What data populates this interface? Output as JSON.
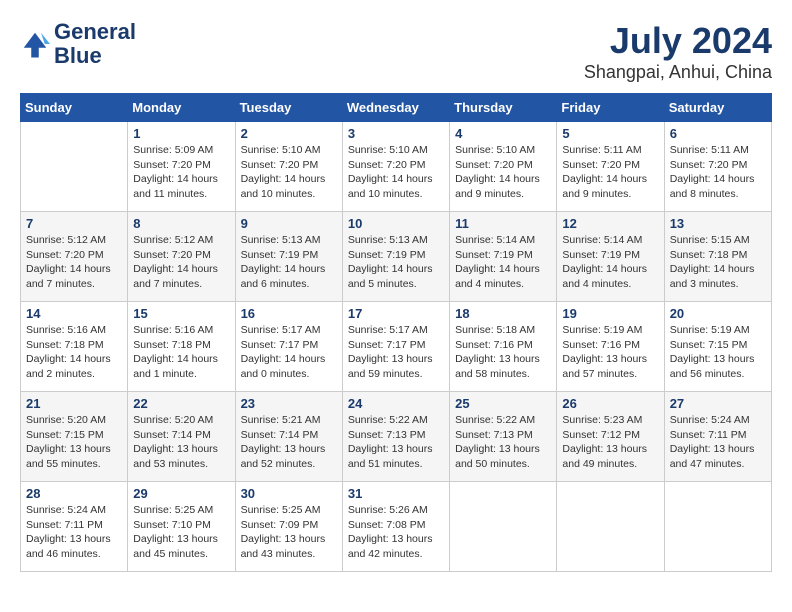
{
  "header": {
    "logo_line1": "General",
    "logo_line2": "Blue",
    "main_title": "July 2024",
    "subtitle": "Shangpai, Anhui, China"
  },
  "calendar": {
    "days_of_week": [
      "Sunday",
      "Monday",
      "Tuesday",
      "Wednesday",
      "Thursday",
      "Friday",
      "Saturday"
    ],
    "weeks": [
      [
        {
          "day": "",
          "info": ""
        },
        {
          "day": "1",
          "info": "Sunrise: 5:09 AM\nSunset: 7:20 PM\nDaylight: 14 hours\nand 11 minutes."
        },
        {
          "day": "2",
          "info": "Sunrise: 5:10 AM\nSunset: 7:20 PM\nDaylight: 14 hours\nand 10 minutes."
        },
        {
          "day": "3",
          "info": "Sunrise: 5:10 AM\nSunset: 7:20 PM\nDaylight: 14 hours\nand 10 minutes."
        },
        {
          "day": "4",
          "info": "Sunrise: 5:10 AM\nSunset: 7:20 PM\nDaylight: 14 hours\nand 9 minutes."
        },
        {
          "day": "5",
          "info": "Sunrise: 5:11 AM\nSunset: 7:20 PM\nDaylight: 14 hours\nand 9 minutes."
        },
        {
          "day": "6",
          "info": "Sunrise: 5:11 AM\nSunset: 7:20 PM\nDaylight: 14 hours\nand 8 minutes."
        }
      ],
      [
        {
          "day": "7",
          "info": "Sunrise: 5:12 AM\nSunset: 7:20 PM\nDaylight: 14 hours\nand 7 minutes."
        },
        {
          "day": "8",
          "info": "Sunrise: 5:12 AM\nSunset: 7:20 PM\nDaylight: 14 hours\nand 7 minutes."
        },
        {
          "day": "9",
          "info": "Sunrise: 5:13 AM\nSunset: 7:19 PM\nDaylight: 14 hours\nand 6 minutes."
        },
        {
          "day": "10",
          "info": "Sunrise: 5:13 AM\nSunset: 7:19 PM\nDaylight: 14 hours\nand 5 minutes."
        },
        {
          "day": "11",
          "info": "Sunrise: 5:14 AM\nSunset: 7:19 PM\nDaylight: 14 hours\nand 4 minutes."
        },
        {
          "day": "12",
          "info": "Sunrise: 5:14 AM\nSunset: 7:19 PM\nDaylight: 14 hours\nand 4 minutes."
        },
        {
          "day": "13",
          "info": "Sunrise: 5:15 AM\nSunset: 7:18 PM\nDaylight: 14 hours\nand 3 minutes."
        }
      ],
      [
        {
          "day": "14",
          "info": "Sunrise: 5:16 AM\nSunset: 7:18 PM\nDaylight: 14 hours\nand 2 minutes."
        },
        {
          "day": "15",
          "info": "Sunrise: 5:16 AM\nSunset: 7:18 PM\nDaylight: 14 hours\nand 1 minute."
        },
        {
          "day": "16",
          "info": "Sunrise: 5:17 AM\nSunset: 7:17 PM\nDaylight: 14 hours\nand 0 minutes."
        },
        {
          "day": "17",
          "info": "Sunrise: 5:17 AM\nSunset: 7:17 PM\nDaylight: 13 hours\nand 59 minutes."
        },
        {
          "day": "18",
          "info": "Sunrise: 5:18 AM\nSunset: 7:16 PM\nDaylight: 13 hours\nand 58 minutes."
        },
        {
          "day": "19",
          "info": "Sunrise: 5:19 AM\nSunset: 7:16 PM\nDaylight: 13 hours\nand 57 minutes."
        },
        {
          "day": "20",
          "info": "Sunrise: 5:19 AM\nSunset: 7:15 PM\nDaylight: 13 hours\nand 56 minutes."
        }
      ],
      [
        {
          "day": "21",
          "info": "Sunrise: 5:20 AM\nSunset: 7:15 PM\nDaylight: 13 hours\nand 55 minutes."
        },
        {
          "day": "22",
          "info": "Sunrise: 5:20 AM\nSunset: 7:14 PM\nDaylight: 13 hours\nand 53 minutes."
        },
        {
          "day": "23",
          "info": "Sunrise: 5:21 AM\nSunset: 7:14 PM\nDaylight: 13 hours\nand 52 minutes."
        },
        {
          "day": "24",
          "info": "Sunrise: 5:22 AM\nSunset: 7:13 PM\nDaylight: 13 hours\nand 51 minutes."
        },
        {
          "day": "25",
          "info": "Sunrise: 5:22 AM\nSunset: 7:13 PM\nDaylight: 13 hours\nand 50 minutes."
        },
        {
          "day": "26",
          "info": "Sunrise: 5:23 AM\nSunset: 7:12 PM\nDaylight: 13 hours\nand 49 minutes."
        },
        {
          "day": "27",
          "info": "Sunrise: 5:24 AM\nSunset: 7:11 PM\nDaylight: 13 hours\nand 47 minutes."
        }
      ],
      [
        {
          "day": "28",
          "info": "Sunrise: 5:24 AM\nSunset: 7:11 PM\nDaylight: 13 hours\nand 46 minutes."
        },
        {
          "day": "29",
          "info": "Sunrise: 5:25 AM\nSunset: 7:10 PM\nDaylight: 13 hours\nand 45 minutes."
        },
        {
          "day": "30",
          "info": "Sunrise: 5:25 AM\nSunset: 7:09 PM\nDaylight: 13 hours\nand 43 minutes."
        },
        {
          "day": "31",
          "info": "Sunrise: 5:26 AM\nSunset: 7:08 PM\nDaylight: 13 hours\nand 42 minutes."
        },
        {
          "day": "",
          "info": ""
        },
        {
          "day": "",
          "info": ""
        },
        {
          "day": "",
          "info": ""
        }
      ]
    ]
  }
}
